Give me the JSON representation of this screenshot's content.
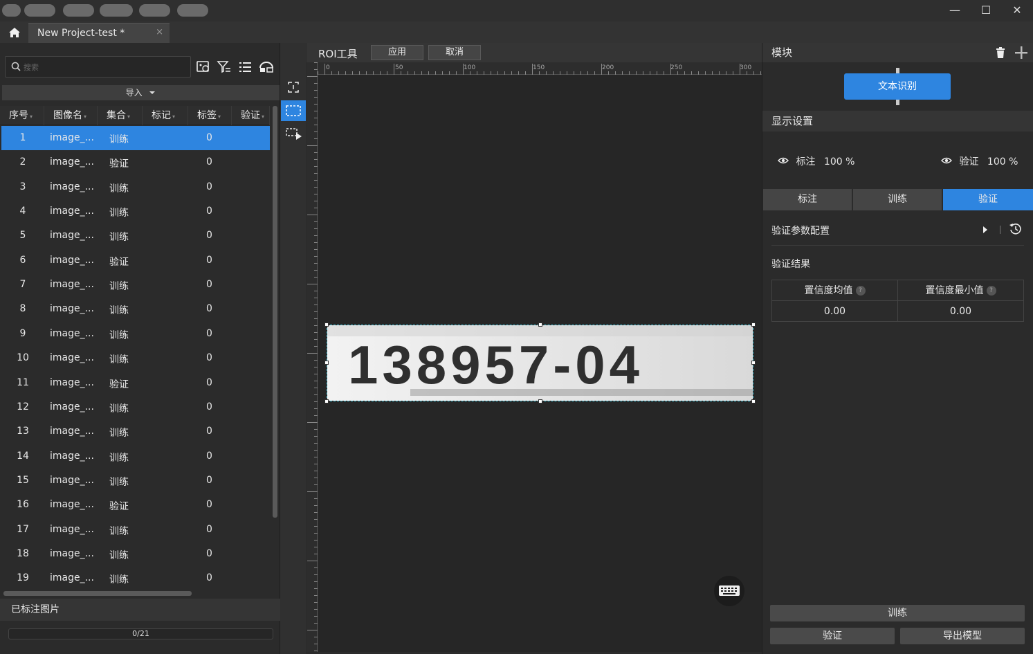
{
  "window": {
    "controls": {
      "minimize": "—",
      "maximize": "☐",
      "close": "✕"
    }
  },
  "tab": {
    "title": "New Project-test *",
    "close": "×"
  },
  "left": {
    "search_placeholder": "搜索",
    "import_label": "导入",
    "columns": [
      "序号",
      "图像名",
      "集合",
      "标记",
      "标签",
      "验证"
    ],
    "rows": [
      {
        "n": "1",
        "name": "image_...",
        "set": "训练",
        "tag": "0"
      },
      {
        "n": "2",
        "name": "image_...",
        "set": "验证",
        "tag": "0"
      },
      {
        "n": "3",
        "name": "image_...",
        "set": "训练",
        "tag": "0"
      },
      {
        "n": "4",
        "name": "image_...",
        "set": "训练",
        "tag": "0"
      },
      {
        "n": "5",
        "name": "image_...",
        "set": "训练",
        "tag": "0"
      },
      {
        "n": "6",
        "name": "image_...",
        "set": "验证",
        "tag": "0"
      },
      {
        "n": "7",
        "name": "image_...",
        "set": "训练",
        "tag": "0"
      },
      {
        "n": "8",
        "name": "image_...",
        "set": "训练",
        "tag": "0"
      },
      {
        "n": "9",
        "name": "image_...",
        "set": "训练",
        "tag": "0"
      },
      {
        "n": "10",
        "name": "image_...",
        "set": "训练",
        "tag": "0"
      },
      {
        "n": "11",
        "name": "image_...",
        "set": "验证",
        "tag": "0"
      },
      {
        "n": "12",
        "name": "image_...",
        "set": "训练",
        "tag": "0"
      },
      {
        "n": "13",
        "name": "image_...",
        "set": "训练",
        "tag": "0"
      },
      {
        "n": "14",
        "name": "image_...",
        "set": "训练",
        "tag": "0"
      },
      {
        "n": "15",
        "name": "image_...",
        "set": "训练",
        "tag": "0"
      },
      {
        "n": "16",
        "name": "image_...",
        "set": "验证",
        "tag": "0"
      },
      {
        "n": "17",
        "name": "image_...",
        "set": "训练",
        "tag": "0"
      },
      {
        "n": "18",
        "name": "image_...",
        "set": "训练",
        "tag": "0"
      },
      {
        "n": "19",
        "name": "image_...",
        "set": "训练",
        "tag": "0"
      }
    ],
    "labeled_title": "已标注图片",
    "progress": "0/21"
  },
  "canvas": {
    "title": "ROI工具",
    "apply": "应用",
    "cancel": "取消",
    "ruler_labels": [
      "0",
      "50",
      "100",
      "150",
      "200",
      "250",
      "300"
    ],
    "image_text": "138957-04"
  },
  "right": {
    "module_title": "模块",
    "module_button": "文本识别",
    "display_title": "显示设置",
    "annot_label": "标注",
    "annot_pct": "100 %",
    "verify_label": "验证",
    "verify_pct": "100 %",
    "tabs": [
      "标注",
      "训练",
      "验证"
    ],
    "param_config": "验证参数配置",
    "result_title": "验证结果",
    "col_mean": "置信度均值",
    "col_min": "置信度最小值",
    "val_mean": "0.00",
    "val_min": "0.00",
    "train_btn": "训练",
    "verify_btn": "验证",
    "export_btn": "导出模型"
  },
  "colors": {
    "accent": "#2e85e0",
    "roi": "#3fc2d9"
  }
}
